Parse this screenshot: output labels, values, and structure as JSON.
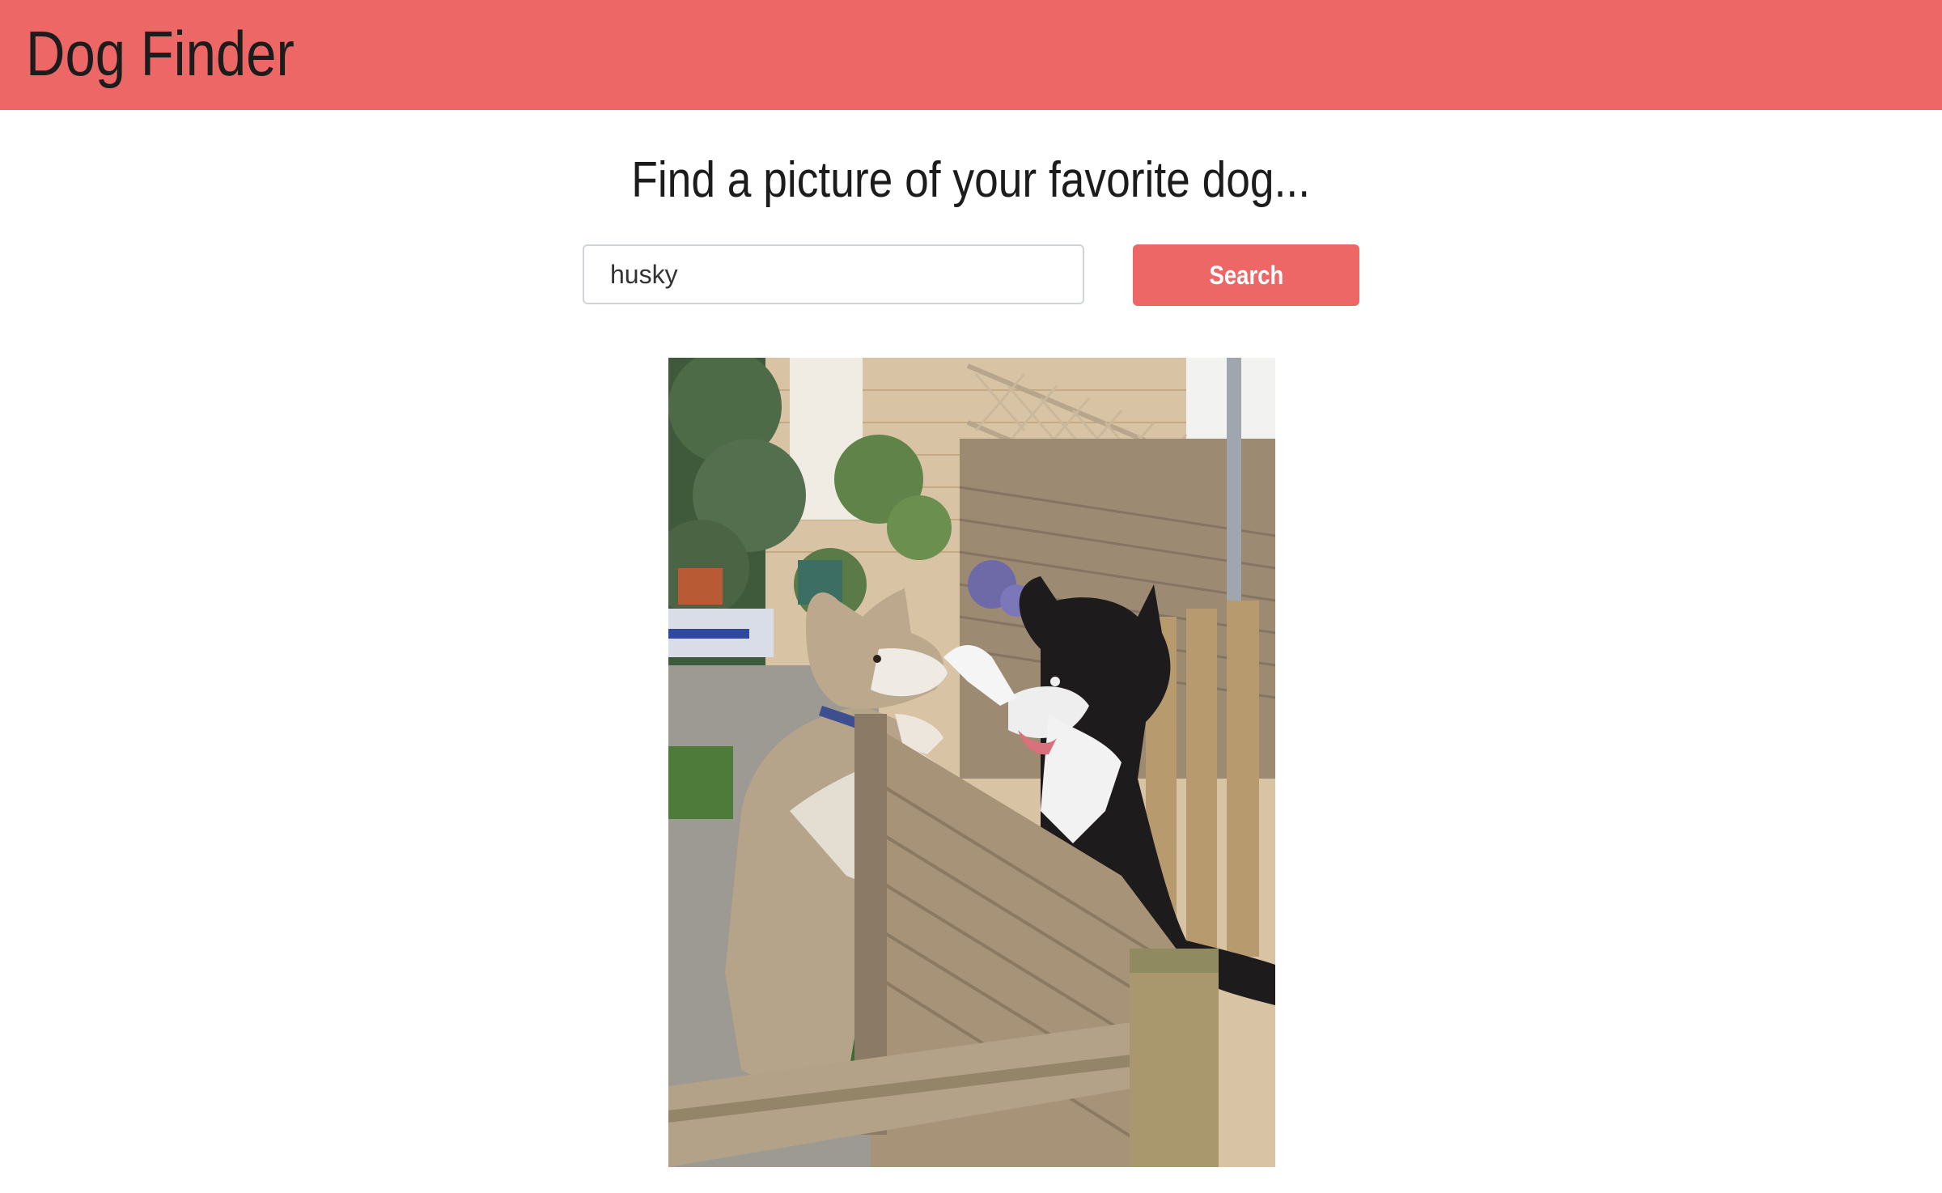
{
  "header": {
    "title": "Dog Finder",
    "background_color": "#ec6766"
  },
  "main": {
    "heading": "Find a picture of your favorite dog...",
    "search": {
      "value": "husky",
      "button_label": "Search",
      "button_color": "#ec6766"
    },
    "result_image": {
      "subject": "husky"
    }
  }
}
